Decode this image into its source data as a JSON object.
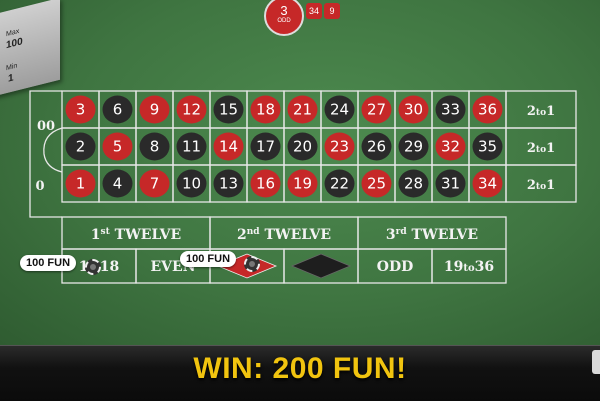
{
  "limits": {
    "max_caption": "Max",
    "max_value": "100",
    "min_caption": "Min",
    "min_value": "1"
  },
  "last_result": {
    "number": "3",
    "tag": "ODD",
    "color": "#c62828"
  },
  "history": [
    {
      "number": "34",
      "color": "#c62828"
    },
    {
      "number": "9",
      "color": "#c62828"
    }
  ],
  "table": {
    "zero_labels": [
      "00",
      "0"
    ],
    "rows": [
      [
        {
          "n": "3",
          "c": "red"
        },
        {
          "n": "6",
          "c": "black"
        },
        {
          "n": "9",
          "c": "red"
        },
        {
          "n": "12",
          "c": "red"
        },
        {
          "n": "15",
          "c": "black"
        },
        {
          "n": "18",
          "c": "red"
        },
        {
          "n": "21",
          "c": "red"
        },
        {
          "n": "24",
          "c": "black"
        },
        {
          "n": "27",
          "c": "red"
        },
        {
          "n": "30",
          "c": "red"
        },
        {
          "n": "33",
          "c": "black"
        },
        {
          "n": "36",
          "c": "red"
        }
      ],
      [
        {
          "n": "2",
          "c": "black"
        },
        {
          "n": "5",
          "c": "red"
        },
        {
          "n": "8",
          "c": "black"
        },
        {
          "n": "11",
          "c": "black"
        },
        {
          "n": "14",
          "c": "red"
        },
        {
          "n": "17",
          "c": "black"
        },
        {
          "n": "20",
          "c": "black"
        },
        {
          "n": "23",
          "c": "red"
        },
        {
          "n": "26",
          "c": "black"
        },
        {
          "n": "29",
          "c": "black"
        },
        {
          "n": "32",
          "c": "red"
        },
        {
          "n": "35",
          "c": "black"
        }
      ],
      [
        {
          "n": "1",
          "c": "red"
        },
        {
          "n": "4",
          "c": "black"
        },
        {
          "n": "7",
          "c": "red"
        },
        {
          "n": "10",
          "c": "black"
        },
        {
          "n": "13",
          "c": "black"
        },
        {
          "n": "16",
          "c": "red"
        },
        {
          "n": "19",
          "c": "red"
        },
        {
          "n": "22",
          "c": "black"
        },
        {
          "n": "25",
          "c": "red"
        },
        {
          "n": "28",
          "c": "black"
        },
        {
          "n": "31",
          "c": "black"
        },
        {
          "n": "34",
          "c": "red"
        }
      ]
    ],
    "column_bets": [
      [
        "2",
        "to",
        "1"
      ],
      [
        "2",
        "to",
        "1"
      ],
      [
        "2",
        "to",
        "1"
      ]
    ],
    "dozens": [
      [
        "1",
        "st",
        " TWELVE"
      ],
      [
        "2",
        "nd",
        " TWELVE"
      ],
      [
        "3",
        "rd",
        " TWELVE"
      ]
    ],
    "outside": [
      "1to18",
      "EVEN",
      "",
      "",
      "ODD",
      "19to36"
    ],
    "colors": {
      "red": "#c62828",
      "black": "#2a2a2a",
      "line": "#e8e8e8"
    }
  },
  "chips": [
    {
      "label": "100 FUN"
    },
    {
      "label": "100 FUN"
    }
  ],
  "win_text": "WIN: 200 FUN!"
}
